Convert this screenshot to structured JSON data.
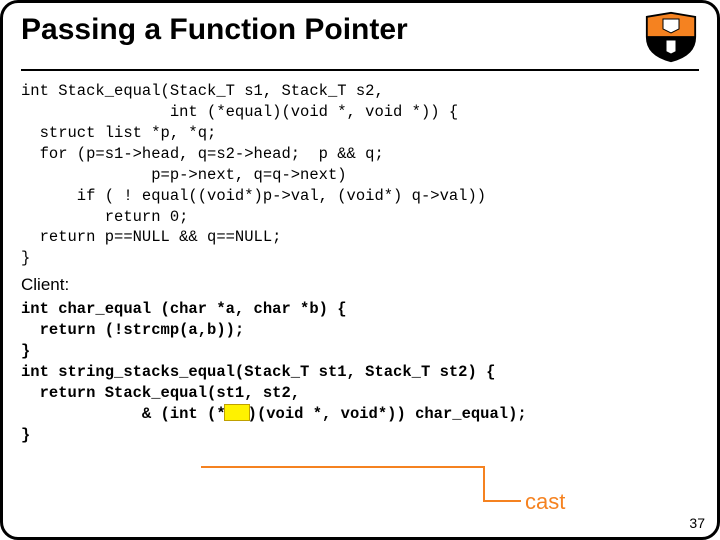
{
  "title": "Passing a Function Pointer",
  "code_block1": "int Stack_equal(Stack_T s1, Stack_T s2,\n                int (*equal)(void *, void *)) {\n  struct list *p, *q;\n  for (p=s1->head, q=s2->head;  p && q;\n              p=p->next, q=q->next)\n      if ( ! equal((void*)p->val, (void*) q->val))\n         return 0;\n  return p==NULL && q==NULL;\n}",
  "client_label": "Client:",
  "code_block2_l1": "int char_equal (char *a, char *b) {",
  "code_block2_l2": "  return (!strcmp(a,b));",
  "code_block2_l3": "}",
  "code_block2_l4": "int string_stacks_equal(Stack_T st1, Stack_T st2) {",
  "code_block2_l5": "  return Stack_equal(st1, st2,",
  "code_block2_l6a": "             & (int (*",
  "code_block2_l6b": ")(void *, void*)) char_equal);",
  "code_block2_l7": "}",
  "cast_label": "cast",
  "page_number": "37"
}
